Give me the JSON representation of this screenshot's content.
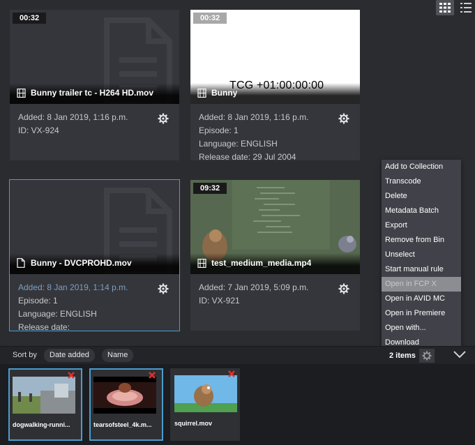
{
  "cards": [
    {
      "duration": "00:32",
      "filename": "Bunny trailer tc - H264 HD.mov",
      "meta": [
        "Added: 8 Jan 2019, 1:16 p.m.",
        "ID: VX-924"
      ]
    },
    {
      "duration": "00:32",
      "filename": "Bunny",
      "overlay_text": "TCG +01:00:00:00",
      "meta": [
        "Added: 8 Jan 2019, 1:16 p.m.",
        "Episode: 1",
        "Language: ENGLISH",
        "Release date: 29 Jul 2004"
      ]
    },
    {
      "filename": "Bunny - DVCPROHD.mov",
      "meta_label": "Added: 8 Jan 2019, 1:14 p.m.",
      "meta": [
        "Episode: 1",
        "Language: ENGLISH",
        "Release date:"
      ]
    },
    {
      "duration": "09:32",
      "filename": "test_medium_media.mp4",
      "meta": [
        "Added: 7 Jan 2019, 5:09 p.m.",
        "ID: VX-921"
      ]
    }
  ],
  "context_menu": {
    "items": [
      "Add to Collection",
      "Transcode",
      "Delete",
      "Metadata Batch",
      "Export",
      "Remove from Bin",
      "Unselect",
      "Start manual rule",
      "Open in FCP X",
      "Open in AVID MC",
      "Open in Premiere",
      "Open with...",
      "Download"
    ],
    "disabled_item": "Open in FCP X"
  },
  "bottom_bar": {
    "sort_label": "Sort by",
    "sort_options": [
      "Date added",
      "Name"
    ],
    "items_count": "2 items"
  },
  "basket": [
    {
      "name": "dogwalking-runni..."
    },
    {
      "name": "tearsofsteel_4k.m..."
    },
    {
      "name": "squirrel.mov"
    }
  ],
  "colors": {
    "background": "#2b2c30",
    "card": "#35363b",
    "selection": "#4b9ccc",
    "menu": "#414249",
    "remove": "#e03030"
  }
}
